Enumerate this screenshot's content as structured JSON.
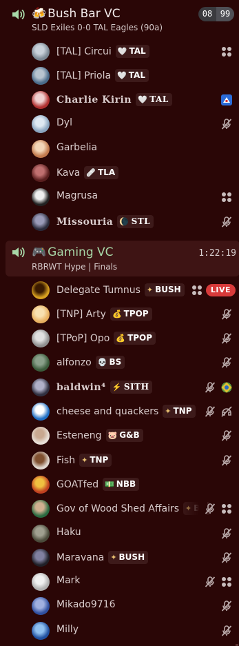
{
  "channels": [
    {
      "name": "Bush Bar VC",
      "emoji": "🍻",
      "status": "SLD Exiles 0-0 TAL Eagles (90a)",
      "counter": [
        "08",
        "99"
      ],
      "users": [
        {
          "name": "[TAL] Circui",
          "tag": {
            "icon": "heart",
            "label": "TAL"
          },
          "av": [
            "#7b8894",
            "#c9d1da"
          ],
          "right": [
            "deafen-grid"
          ]
        },
        {
          "name": "[TAL] Priola",
          "tag": {
            "icon": "heart",
            "label": "TAL"
          },
          "av": [
            "#4a6b8a",
            "#b8c4cf"
          ],
          "right": []
        },
        {
          "name": "Charlie Kirin",
          "special": true,
          "tag": {
            "icon": "heart",
            "label": "TAL"
          },
          "av": [
            "#b03030",
            "#f0d0d0"
          ],
          "right": [
            "app-square"
          ]
        },
        {
          "name": "Dyl",
          "av": [
            "#8aa4bf",
            "#dfe8f2"
          ],
          "right": [
            "mute"
          ]
        },
        {
          "name": "Garbelia",
          "av": [
            "#c27a4e",
            "#f3d6b8"
          ],
          "right": []
        },
        {
          "name": "Kava",
          "tag": {
            "icon": "bandage",
            "label": "TLA"
          },
          "av": [
            "#5a1f1f",
            "#c07070"
          ],
          "right": []
        },
        {
          "name": "Magrusa",
          "av": [
            "#222",
            "#eee"
          ],
          "right": [
            "deafen-grid"
          ]
        },
        {
          "name": "Missouria",
          "special": true,
          "tag": {
            "icon": "moon",
            "label": "STL"
          },
          "av": [
            "#2a2a3a",
            "#9a9ab8"
          ],
          "right": [
            "mute"
          ]
        }
      ]
    },
    {
      "name": "Gaming VC",
      "emoji": "🎮",
      "status": "RBRWT Hype | Finals",
      "timer": "1:22:19",
      "users": [
        {
          "name": "Delegate Tumnus",
          "tag": {
            "icon": "diamond",
            "label": "BUSH"
          },
          "av": [
            "#d8a020",
            "#3a1a00"
          ],
          "right": [
            "deafen-grid",
            "live"
          ]
        },
        {
          "name": "[TNP] Arty",
          "tag": {
            "icon": "bag",
            "label": "TPOP"
          },
          "av": [
            "#e8b060",
            "#f8e0b0"
          ],
          "right": [
            "mute"
          ]
        },
        {
          "name": "[TPoP] Opo",
          "tag": {
            "icon": "bag",
            "label": "TPOP"
          },
          "av": [
            "#909090",
            "#e0e0e0"
          ],
          "right": [
            "mute"
          ]
        },
        {
          "name": "alfonzo",
          "tag": {
            "icon": "skull",
            "label": "BS"
          },
          "av": [
            "#3a5a3a",
            "#8aa08a"
          ],
          "right": [
            "mute"
          ]
        },
        {
          "name": "baldwin⁴",
          "special": true,
          "tag": {
            "icon": "bolt",
            "label": "SITH"
          },
          "av": [
            "#303040",
            "#b0b0c8"
          ],
          "right": [
            "mute",
            "globe"
          ]
        },
        {
          "name": "cheese and quackers",
          "tag": {
            "icon": "diamond",
            "label": "TNP"
          },
          "av": [
            "#1f6fc4",
            "#ffffff"
          ],
          "right": [
            "mute",
            "deafen"
          ]
        },
        {
          "name": "Esteneng",
          "tag": {
            "icon": "pig",
            "label": "G&B"
          },
          "av": [
            "#e8e0d8",
            "#c8a890"
          ],
          "right": [
            "mute"
          ]
        },
        {
          "name": "Fish",
          "tag": {
            "icon": "diamond",
            "label": "TNP"
          },
          "av": [
            "#e0d8d0",
            "#805030"
          ],
          "right": [
            "mute"
          ]
        },
        {
          "name": "GOATfed",
          "tag": {
            "icon": "money",
            "label": "NBB"
          },
          "av": [
            "#c04020",
            "#f0c040"
          ],
          "right": []
        },
        {
          "name": "Gov of Wood Shed Affairs",
          "tag": {
            "icon": "diamond",
            "label": "BU"
          },
          "av": [
            "#2a6a40",
            "#d0b090"
          ],
          "right": [
            "mute",
            "deafen-grid"
          ],
          "fade": true
        },
        {
          "name": "Haku",
          "av": [
            "#4a4a3a",
            "#a0a090"
          ],
          "right": [
            "mute"
          ]
        },
        {
          "name": "Maravana",
          "tag": {
            "icon": "diamond",
            "label": "BUSH"
          },
          "av": [
            "#202028",
            "#8080a0"
          ],
          "right": [
            "mute"
          ]
        },
        {
          "name": "Mark",
          "av": [
            "#b0b0b0",
            "#f0f0f0"
          ],
          "right": [
            "mute",
            "deafen-grid"
          ]
        },
        {
          "name": "Mikado9716",
          "av": [
            "#3050a0",
            "#a0b0e0"
          ],
          "right": [
            "mute"
          ]
        },
        {
          "name": "Milly",
          "av": [
            "#2050a0",
            "#90c0f0"
          ],
          "right": [
            "mute"
          ]
        }
      ]
    }
  ],
  "live_label": "LIVE",
  "colors": {
    "background": "#2a0606",
    "active_channel": "#3e1414",
    "live_badge": "#d83a3a",
    "speaker": "#a8d8a8"
  }
}
